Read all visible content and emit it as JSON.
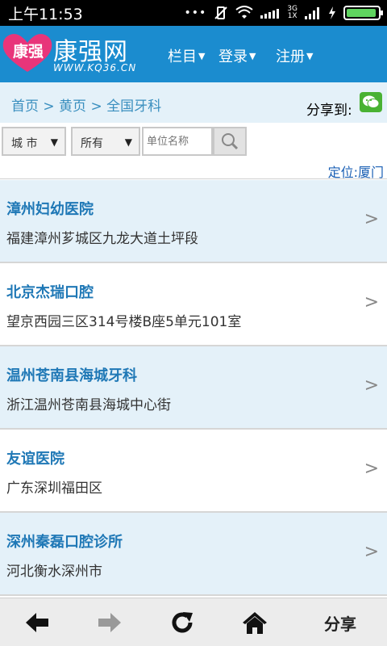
{
  "status_bar": {
    "time": "上午11:53",
    "network_top": "3G",
    "network_bottom": "1X",
    "battery_level": 0.95
  },
  "header": {
    "logo_badge": "康强",
    "logo_title": "康强网",
    "logo_url": "WWW.KQ36.CN",
    "nav": [
      {
        "label": "栏目"
      },
      {
        "label": "登录"
      },
      {
        "label": "注册"
      }
    ],
    "brand_color": "#1b8ccf"
  },
  "breadcrumb": {
    "text": "首页 > 黄页 > 全国牙科",
    "share_label": "分享到:"
  },
  "search": {
    "city_select": "城 市",
    "type_select": "所有",
    "unit_placeholder": "单位名称",
    "location": "定位:厦门"
  },
  "listings": [
    {
      "name": "漳州妇幼医院",
      "address": "福建漳州芗城区九龙大道土坪段"
    },
    {
      "name": "北京杰瑞口腔",
      "address": "望京西园三区314号楼B座5单元101室"
    },
    {
      "name": "温州苍南县海城牙科",
      "address": "浙江温州苍南县海城中心街"
    },
    {
      "name": "友谊医院",
      "address": "广东深圳福田区"
    },
    {
      "name": "深州秦磊口腔诊所",
      "address": "河北衡水深州市"
    }
  ],
  "toolbar": {
    "share_label": "分享"
  },
  "icons": [
    "back-arrow-icon",
    "forward-arrow-icon",
    "refresh-icon",
    "home-icon",
    "search-icon",
    "wechat-icon",
    "chevron-right-icon"
  ]
}
